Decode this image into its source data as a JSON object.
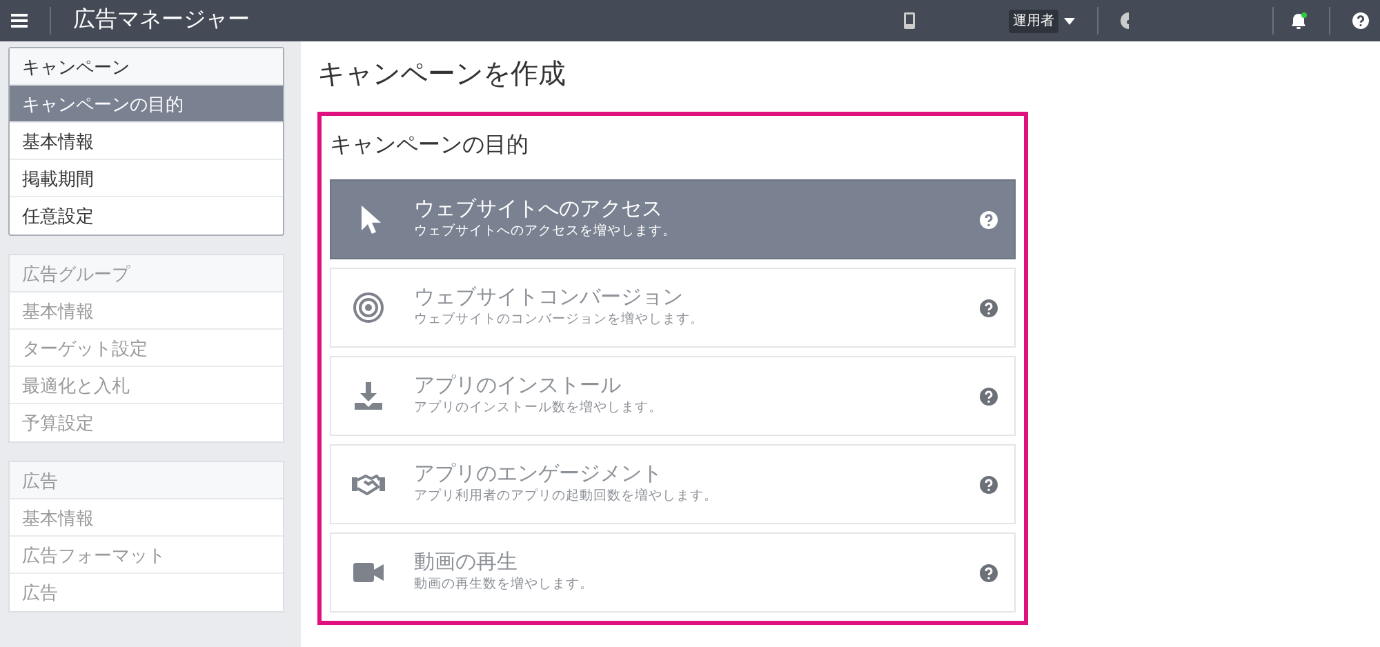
{
  "topbar": {
    "title": "広告マネージャー",
    "role": "運用者",
    "notification_unread": true
  },
  "sidebar": {
    "groups": [
      {
        "header": "キャンペーン",
        "disabled": false,
        "items": [
          {
            "label": "キャンペーンの目的",
            "selected": true
          },
          {
            "label": "基本情報",
            "selected": false
          },
          {
            "label": "掲載期間",
            "selected": false
          },
          {
            "label": "任意設定",
            "selected": false
          }
        ]
      },
      {
        "header": "広告グループ",
        "disabled": true,
        "items": [
          {
            "label": "基本情報",
            "selected": false
          },
          {
            "label": "ターゲット設定",
            "selected": false
          },
          {
            "label": "最適化と入札",
            "selected": false
          },
          {
            "label": "予算設定",
            "selected": false
          }
        ]
      },
      {
        "header": "広告",
        "disabled": true,
        "items": [
          {
            "label": "基本情報",
            "selected": false
          },
          {
            "label": "広告フォーマット",
            "selected": false
          },
          {
            "label": "広告",
            "selected": false
          }
        ]
      }
    ]
  },
  "page_title": "キャンペーンを作成",
  "objective": {
    "heading": "キャンペーンの目的",
    "options": [
      {
        "kind": "cursor",
        "title": "ウェブサイトへのアクセス",
        "description": "ウェブサイトへのアクセスを増やします。",
        "selected": true
      },
      {
        "kind": "target",
        "title": "ウェブサイトコンバージョン",
        "description": "ウェブサイトのコンバージョンを増やします。",
        "selected": false
      },
      {
        "kind": "download",
        "title": "アプリのインストール",
        "description": "アプリのインストール数を増やします。",
        "selected": false
      },
      {
        "kind": "handshake",
        "title": "アプリのエンゲージメント",
        "description": "アプリ利用者のアプリの起動回数を増やします。",
        "selected": false
      },
      {
        "kind": "video",
        "title": "動画の再生",
        "description": "動画の再生数を増やします。",
        "selected": false
      }
    ]
  }
}
